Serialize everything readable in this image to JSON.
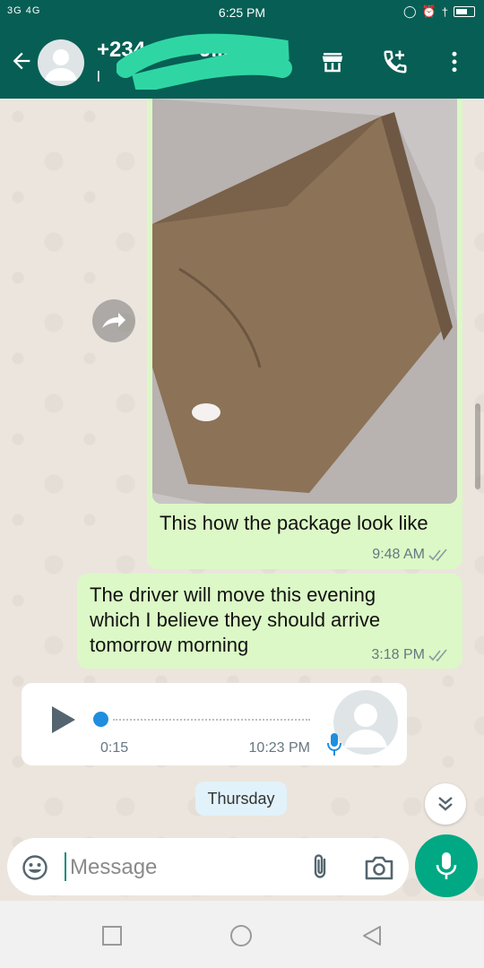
{
  "status_bar": {
    "network_left": "3G 4G",
    "time": "6:25 PM"
  },
  "header": {
    "contact_name": "+234         9...",
    "contact_sub": "l           PM"
  },
  "messages": {
    "image_caption": "This how the package look like",
    "image_time": "9:48 AM",
    "text_body": "The driver  will move this evening which  I believe they should arrive tomorrow morning",
    "text_time": "3:18 PM",
    "voice_duration": "0:15",
    "voice_time": "10:23 PM"
  },
  "day_label": "Thursday",
  "composer": {
    "placeholder": "Message"
  },
  "colors": {
    "header": "#075e54",
    "outgoing_bubble": "#dcf8c6",
    "accent": "#00a884",
    "tick": "#8a9aa4"
  },
  "icons": [
    "back-arrow-icon",
    "avatar-icon",
    "shop-icon",
    "add-call-icon",
    "more-icon",
    "forward-icon",
    "play-icon",
    "mic-icon",
    "double-chevron-down-icon",
    "emoji-icon",
    "attach-icon",
    "camera-icon",
    "square-nav-icon",
    "circle-nav-icon",
    "triangle-nav-icon"
  ]
}
